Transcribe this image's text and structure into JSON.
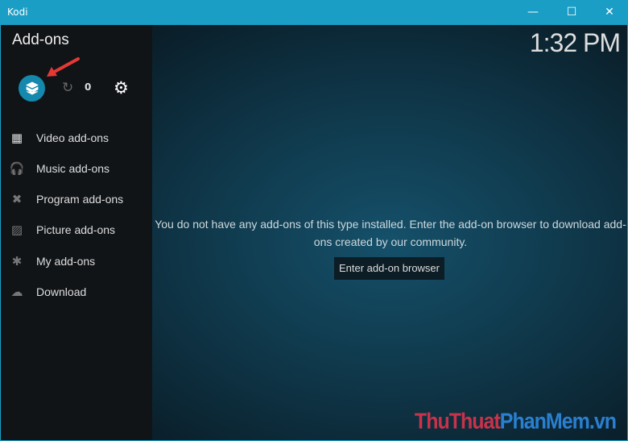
{
  "window": {
    "title": "Kodi",
    "minimize": "—",
    "maximize": "☐",
    "close": "✕"
  },
  "sidebar": {
    "heading": "Add-ons",
    "update_count": "0",
    "items": [
      {
        "label": "Video add-ons",
        "icon": "film-icon"
      },
      {
        "label": "Music add-ons",
        "icon": "headphones-icon"
      },
      {
        "label": "Program add-ons",
        "icon": "tools-icon"
      },
      {
        "label": "Picture add-ons",
        "icon": "picture-icon"
      },
      {
        "label": "My add-ons",
        "icon": "puzzle-gear-icon"
      },
      {
        "label": "Download",
        "icon": "cloud-download-icon"
      }
    ]
  },
  "clock": "1:32 PM",
  "main": {
    "message": "You do not have any add-ons of this type installed. Enter the add-on browser to download add-ons created by our community.",
    "button": "Enter add-on browser"
  },
  "watermark": {
    "part1": "ThuThuat",
    "part2": "PhanMem",
    "part3": ".vn"
  },
  "colors": {
    "accent": "#1a9ec6",
    "sidebar": "#111417",
    "arrow": "#e53935"
  }
}
